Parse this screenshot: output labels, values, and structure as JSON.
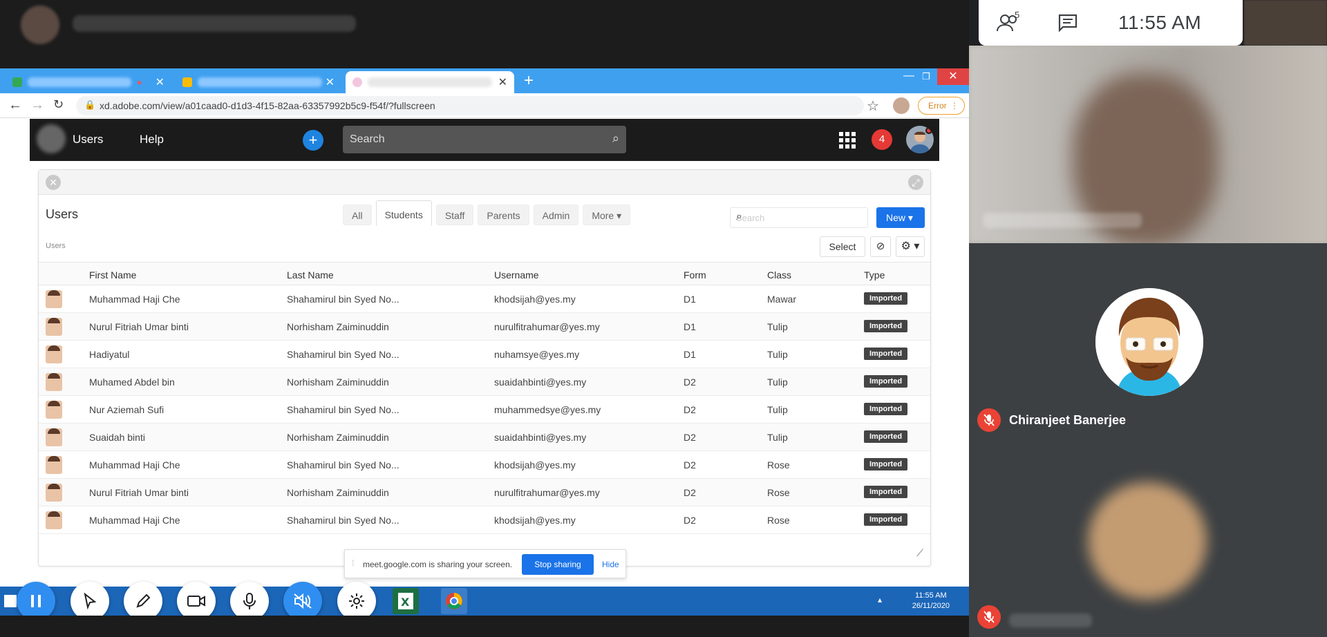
{
  "meet": {
    "participants_count": "5",
    "time": "11:55 AM",
    "participant_name": "Chiranjeet Banerjee",
    "share_bar": {
      "message": "meet.google.com is sharing your screen.",
      "stop_label": "Stop sharing",
      "hide_label": "Hide"
    }
  },
  "browser": {
    "url": "xd.adobe.com/view/a01caad0-d1d3-4f15-82aa-63357992b5c9-f54f/?fullscreen",
    "error_label": "Error"
  },
  "app": {
    "nav": [
      "Users",
      "Help"
    ],
    "search_placeholder": "Search",
    "notification_count": "4"
  },
  "panel": {
    "title": "Users",
    "breadcrumb": "Users",
    "tabs": [
      "All",
      "Students",
      "Staff",
      "Parents",
      "Admin",
      "More ▾"
    ],
    "active_tab": "Students",
    "search_placeholder": "Search",
    "new_label": "New ▾",
    "select_label": "Select",
    "columns": [
      "First Name",
      "Last Name",
      "Username",
      "Form",
      "Class",
      "Type"
    ],
    "rows": [
      [
        "Muhammad Haji Che",
        "Shahamirul bin Syed No...",
        "khodsijah@yes.my",
        "D1",
        "Mawar",
        "Imported"
      ],
      [
        "Nurul Fitriah Umar binti",
        "Norhisham Zaiminuddin",
        "nurulfitrahumar@yes.my",
        "D1",
        "Tulip",
        "Imported"
      ],
      [
        "Hadiyatul",
        "Shahamirul bin Syed No...",
        "nuhamsye@yes.my",
        "D1",
        "Tulip",
        "Imported"
      ],
      [
        "Muhamed Abdel bin",
        "Norhisham Zaiminuddin",
        "suaidahbinti@yes.my",
        "D2",
        "Tulip",
        "Imported"
      ],
      [
        "Nur Aziemah Sufi",
        "Shahamirul bin Syed No...",
        "muhammedsye@yes.my",
        "D2",
        "Tulip",
        "Imported"
      ],
      [
        "Suaidah binti",
        "Norhisham Zaiminuddin",
        "suaidahbinti@yes.my",
        "D2",
        "Tulip",
        "Imported"
      ],
      [
        "Muhammad Haji Che",
        "Shahamirul bin Syed No...",
        "khodsijah@yes.my",
        "D2",
        "Rose",
        "Imported"
      ],
      [
        "Nurul Fitriah Umar binti",
        "Norhisham Zaiminuddin",
        "nurulfitrahumar@yes.my",
        "D2",
        "Rose",
        "Imported"
      ],
      [
        "Muhammad Haji Che",
        "Shahamirul bin Syed No...",
        "khodsijah@yes.my",
        "D2",
        "Rose",
        "Imported"
      ]
    ]
  },
  "taskbar": {
    "time": "11:55 AM",
    "date": "26/11/2020"
  },
  "colors": {
    "accent": "#1a73e8",
    "taskbar": "#1c66b8",
    "tabbar": "#3fa0f0",
    "mic_off": "#ea4335"
  }
}
